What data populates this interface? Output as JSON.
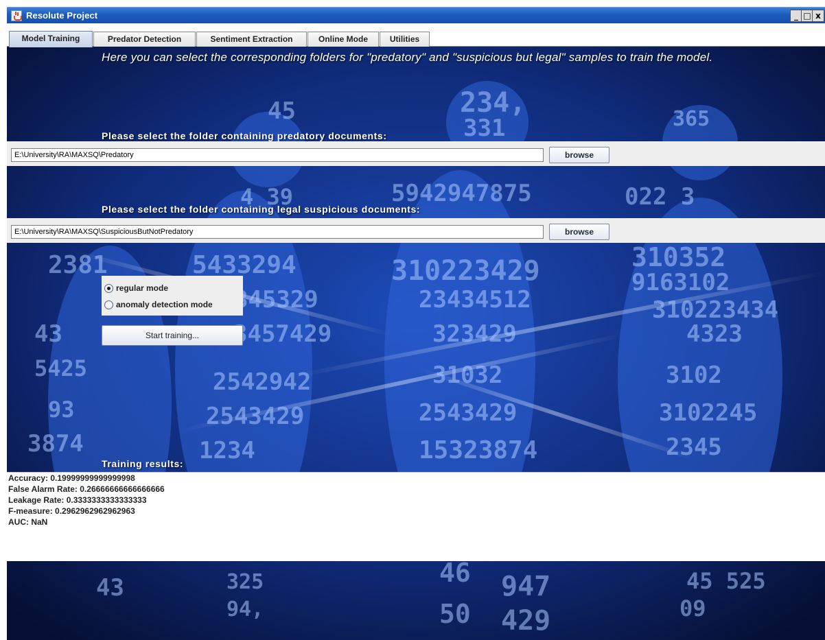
{
  "window": {
    "title": "Resolute Project",
    "controls": [
      "_",
      "□",
      "x"
    ]
  },
  "tabs": [
    {
      "label": "Model Training",
      "active": true
    },
    {
      "label": "Predator Detection",
      "active": false
    },
    {
      "label": "Sentiment Extraction",
      "active": false
    },
    {
      "label": "Online Mode",
      "active": false
    },
    {
      "label": "Utilities",
      "active": false
    }
  ],
  "training": {
    "intro": "Here you can select the corresponding folders for \"predatory\" and \"suspicious but legal\" samples to train the model.",
    "predatory_label": "Please select the folder containing predatory documents:",
    "predatory_path": "E:\\University\\RA\\MAXSQ\\Predatory",
    "legal_label": "Please select the folder containing legal suspicious documents:",
    "legal_path": "E:\\University\\RA\\MAXSQ\\SuspiciousButNotPredatory",
    "browse_label": "browse",
    "modes": [
      {
        "label": "regular mode",
        "selected": true
      },
      {
        "label": "anomaly detection mode",
        "selected": false
      }
    ],
    "start_label": "Start training...",
    "results_label": "Training results:",
    "results": [
      "Accuracy: 0.19999999999999998",
      "False Alarm Rate: 0.26666666666666666",
      "Leakage Rate: 0.3333333333333333",
      "F-measure: 0.2962962962962963",
      "AUC: NaN"
    ]
  },
  "colors": {
    "title_bar": "#1c5bbd",
    "background_dark": "#0a1842",
    "digits": "#9fc3ff"
  }
}
